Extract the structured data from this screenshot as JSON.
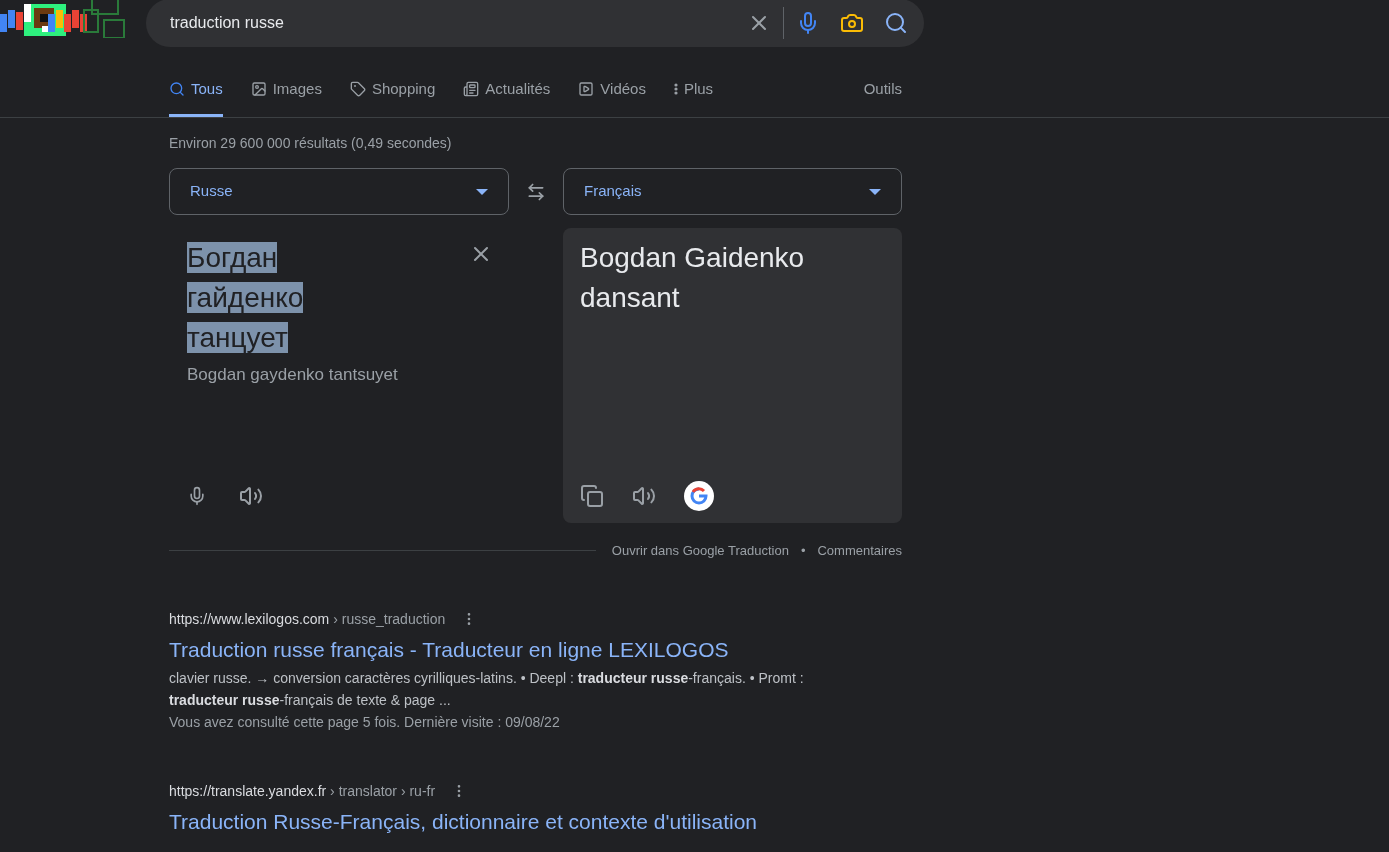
{
  "search": {
    "value": "traduction russe"
  },
  "tabs": [
    {
      "label": "Tous",
      "kind": "all",
      "selected": true
    },
    {
      "label": "Images",
      "kind": "images",
      "selected": false
    },
    {
      "label": "Shopping",
      "kind": "shopping",
      "selected": false
    },
    {
      "label": "Actualités",
      "kind": "news",
      "selected": false
    },
    {
      "label": "Vidéos",
      "kind": "videos",
      "selected": false
    },
    {
      "label": "Plus",
      "kind": "more",
      "selected": false
    }
  ],
  "tools": "Outils",
  "result_stats": "Environ 29 600 000 résultats (0,49 secondes)",
  "translator": {
    "source_language": "Russe",
    "target_language": "Français",
    "source_text": "Богдан гайденко танцует",
    "source_selected": true,
    "transliteration": "Bogdan gaydenko tantsuyet",
    "translation": "Bogdan Gaidenko dansant",
    "open_link": "Ouvrir dans Google Traduction",
    "separator": "•",
    "feedback_link": "Commentaires"
  },
  "results": [
    {
      "site": "https://www.lexilogos.com",
      "path": " › russe_traduction",
      "title": "Traduction russe français - Traducteur en ligne LEXILOGOS",
      "snippet": "clavier russe. → conversion caractères cyrilliques-latins. • Deepl : **traducteur russe**-français. • Promt : **traducteur russe**-français de texte & page ...",
      "visited": "Vous avez consulté cette page 5 fois. Dernière visite : 09/08/22"
    },
    {
      "site": "https://translate.yandex.fr",
      "path": " › translator › ru-fr",
      "title": "Traduction Russe-Français, dictionnaire et contexte d'utilisation"
    }
  ]
}
